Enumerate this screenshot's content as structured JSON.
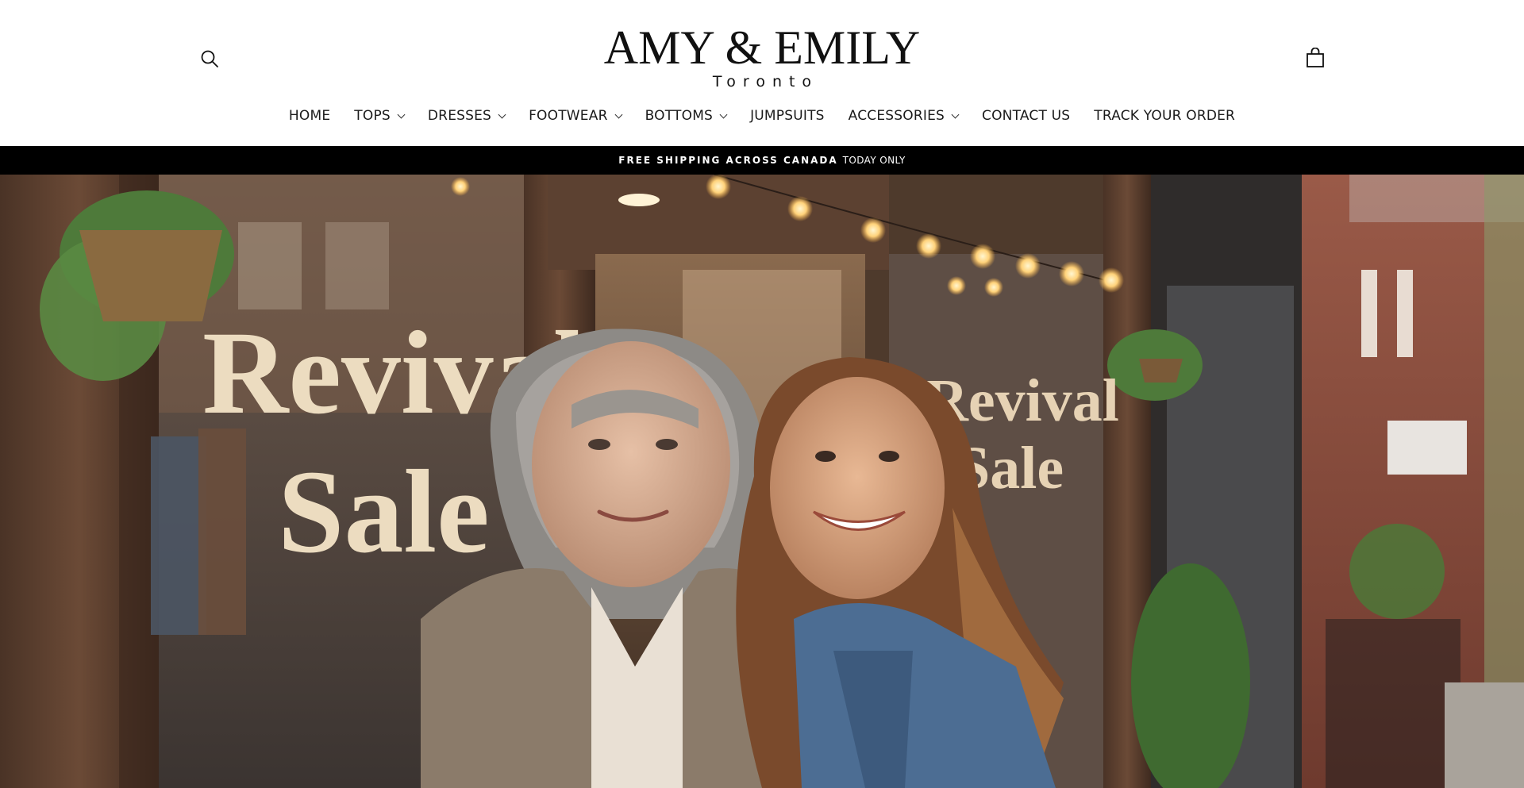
{
  "header": {
    "logo_main": "AMY & EMILY",
    "logo_sub": "Toronto",
    "search_icon": "search-icon",
    "cart_icon": "shopping-bag-icon"
  },
  "nav": {
    "items": [
      {
        "label": "HOME",
        "has_dropdown": false
      },
      {
        "label": "TOPS",
        "has_dropdown": true
      },
      {
        "label": "DRESSES",
        "has_dropdown": true
      },
      {
        "label": "FOOTWEAR",
        "has_dropdown": true
      },
      {
        "label": "BOTTOMS",
        "has_dropdown": true
      },
      {
        "label": "JUMPSUITS",
        "has_dropdown": false
      },
      {
        "label": "ACCESSORIES",
        "has_dropdown": true
      },
      {
        "label": "CONTACT US",
        "has_dropdown": false
      },
      {
        "label": "TRACK YOUR ORDER",
        "has_dropdown": false
      }
    ]
  },
  "announcement": {
    "strong": "FREE SHIPPING ACROSS CANADA",
    "rest": "TODAY ONLY"
  },
  "hero": {
    "window_sign_left": [
      "Revival",
      "Sale"
    ],
    "window_sign_right": [
      "Revival",
      "Sale"
    ]
  },
  "colors": {
    "announcement_bg": "#000000",
    "text": "#111111",
    "background": "#ffffff"
  }
}
